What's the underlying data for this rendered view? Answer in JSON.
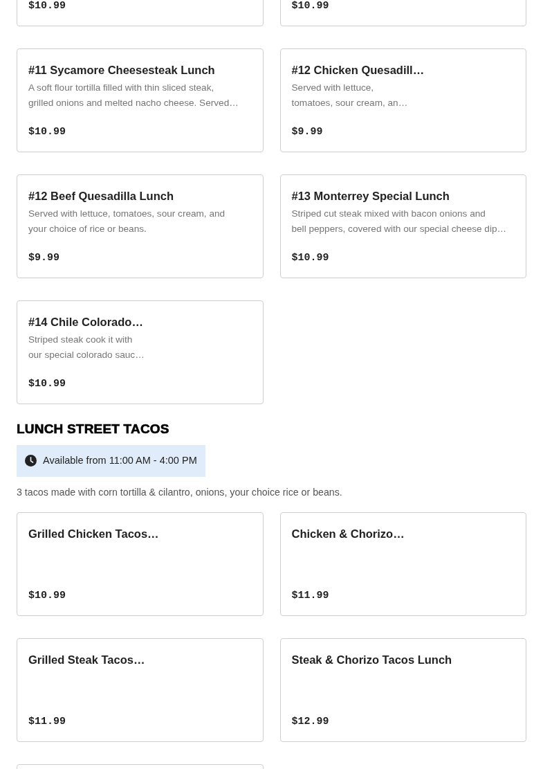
{
  "sections": [
    {
      "items": [
        {
          "kind": "item",
          "price": "$10.99"
        },
        {
          "kind": "item",
          "price": "$10.99"
        },
        {
          "kind": "item",
          "title": "#11 Sycamore Cheesesteak Lunch",
          "description": "A soft flour tortilla filled with thin sliced steak,\ngrilled onions and melted nacho cheese. Served…",
          "price": "$10.99"
        },
        {
          "kind": "item",
          "title": "#12 Chicken Quesadill…",
          "description": "Served with lettuce,\ntomatoes, sour cream, an…",
          "price": "$9.99"
        },
        {
          "kind": "item",
          "title": "#12 Beef Quesadilla Lunch",
          "description": "Served with lettuce, tomatoes, sour cream, and\nyour choice of rice or beans.",
          "price": "$9.99"
        },
        {
          "kind": "item",
          "title": "#13 Monterrey Special Lunch",
          "description": "Striped cut steak mixed with bacon onions and\nbell peppers, covered with our special cheese dip…",
          "price": "$10.99"
        },
        {
          "kind": "item",
          "title": "#14 Chile Colorado…",
          "description": "Striped steak cook it with\nour special colorado sauc…",
          "price": "$10.99"
        }
      ]
    },
    {
      "title": "LUNCH STREET TACOS",
      "availability": "Available from 11:00 AM - 4:00 PM",
      "note": "3 tacos made with corn tortilla & cilantro, onions, your choice rice or beans.",
      "items": [
        {
          "kind": "item",
          "title": "Grilled Chicken Tacos…",
          "price": "$10.99"
        },
        {
          "kind": "item",
          "title": "Chicken & Chorizo…",
          "price": "$11.99"
        },
        {
          "kind": "item",
          "title": "Grilled Steak Tacos…",
          "price": "$11.99"
        },
        {
          "kind": "item",
          "title": "Steak & Chorizo Tacos Lunch",
          "price": "$12.99"
        },
        {
          "kind": "cut"
        }
      ]
    }
  ]
}
